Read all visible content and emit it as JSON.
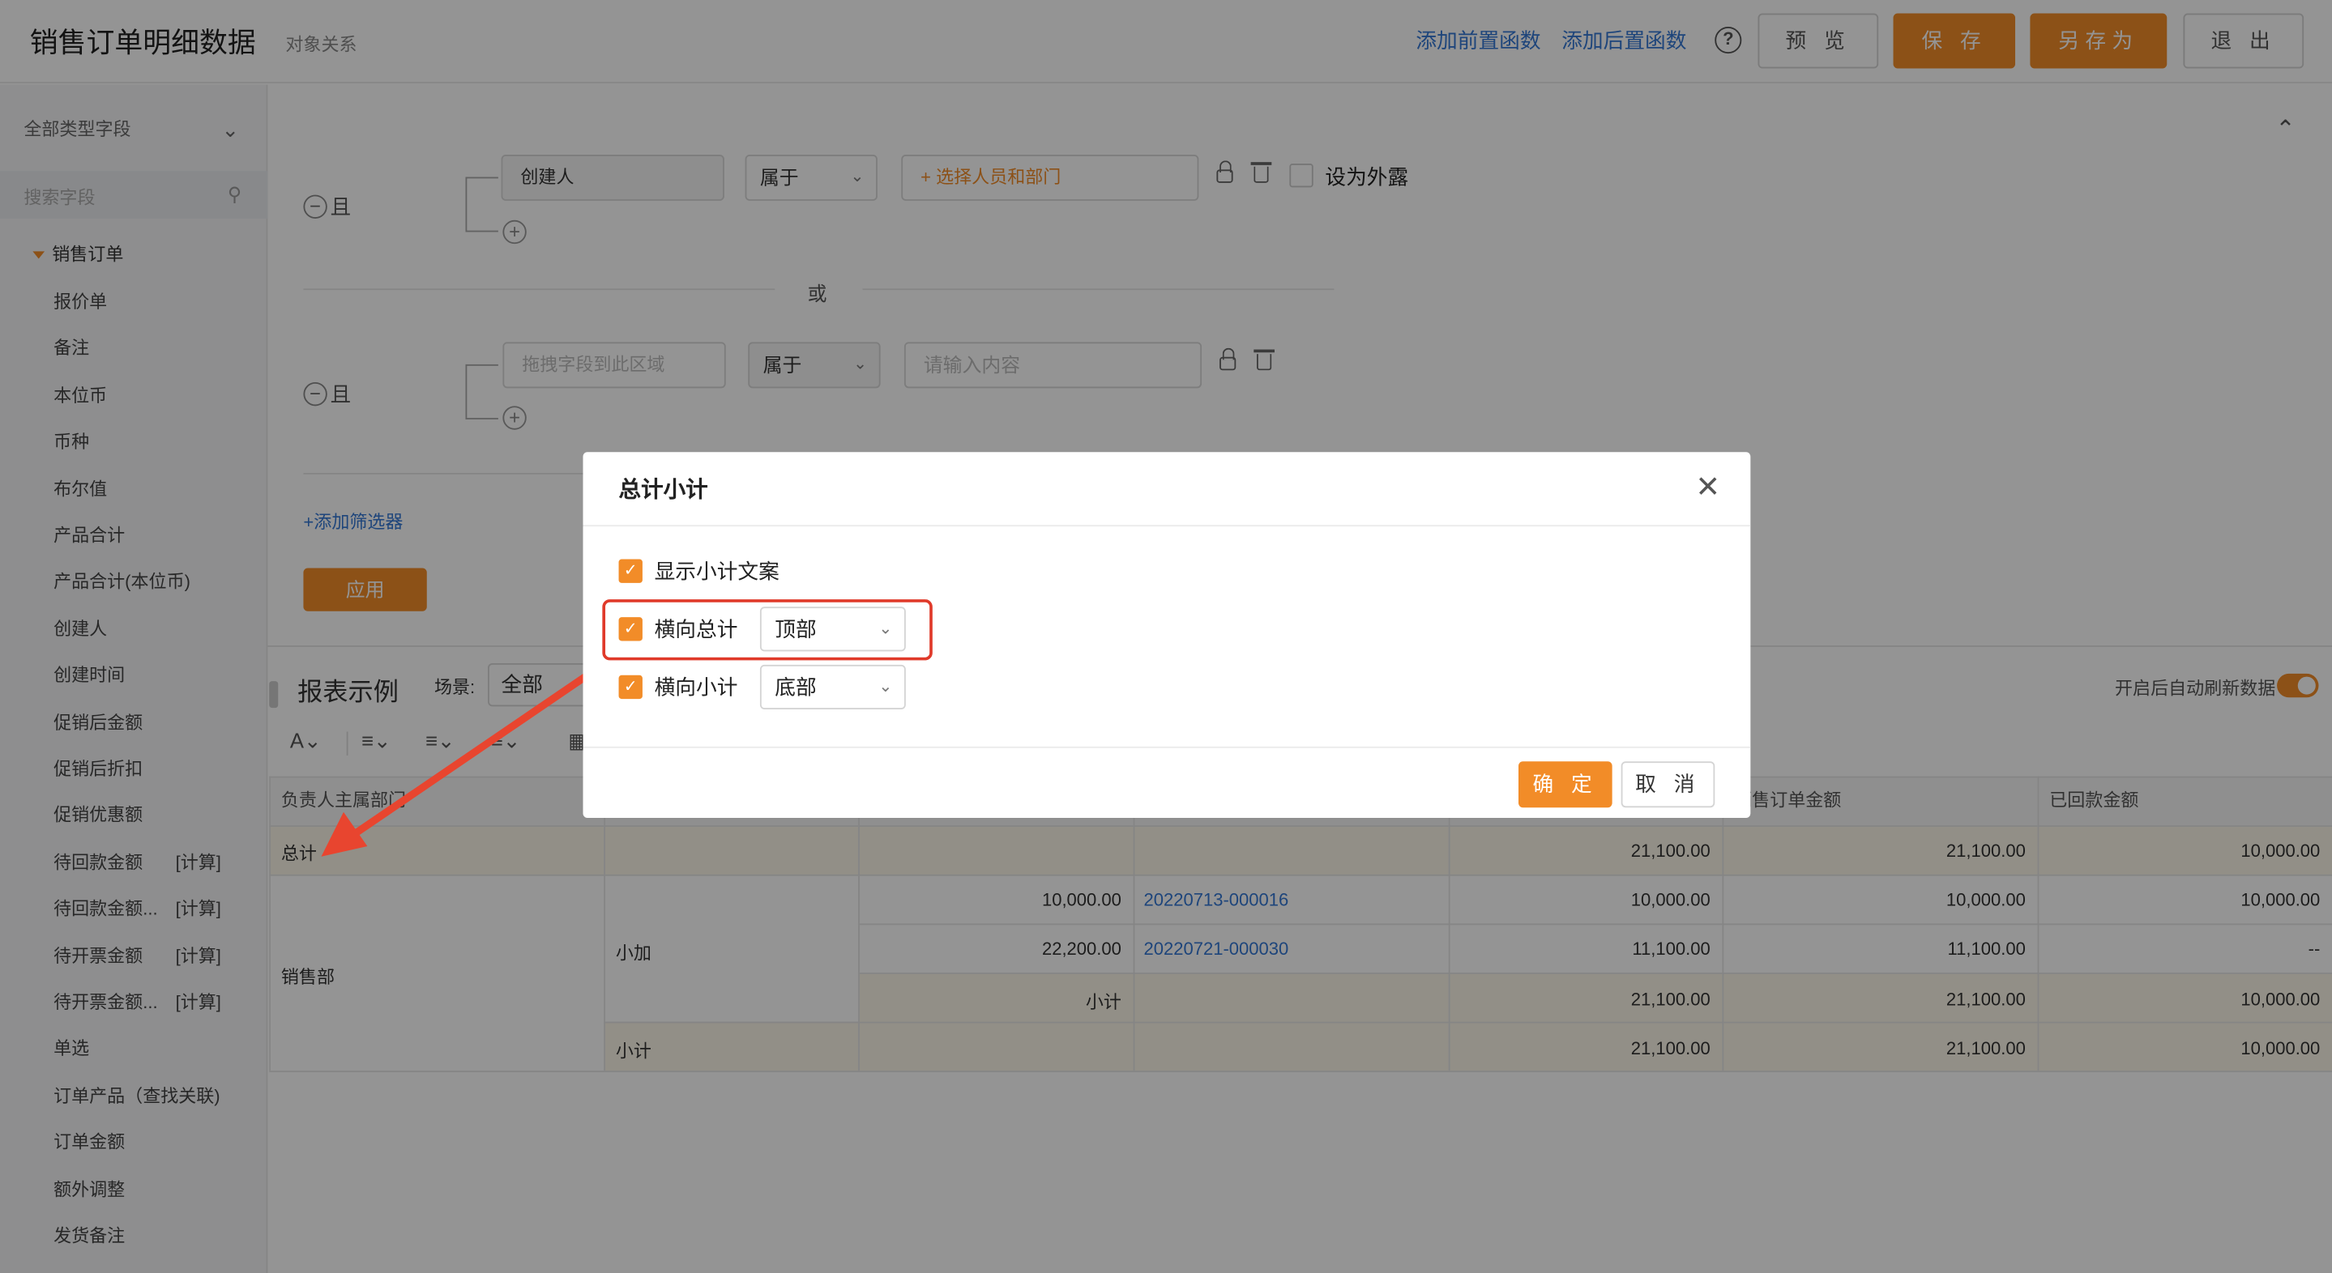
{
  "header": {
    "title": "销售订单明细数据",
    "subtitle": "对象关系",
    "add_pre_func": "添加前置函数",
    "add_post_func": "添加后置函数",
    "help": "?",
    "preview": "预 览",
    "save": "保 存",
    "save_as": "另存为",
    "exit": "退 出"
  },
  "sidebar": {
    "type_select": "全部类型字段",
    "search_placeholder": "搜索字段",
    "root": "销售订单",
    "items": [
      {
        "label": "报价单",
        "tag": ""
      },
      {
        "label": "备注",
        "tag": ""
      },
      {
        "label": "本位币",
        "tag": ""
      },
      {
        "label": "币种",
        "tag": ""
      },
      {
        "label": "布尔值",
        "tag": ""
      },
      {
        "label": "产品合计",
        "tag": ""
      },
      {
        "label": "产品合计(本位币)",
        "tag": ""
      },
      {
        "label": "创建人",
        "tag": ""
      },
      {
        "label": "创建时间",
        "tag": ""
      },
      {
        "label": "促销后金额",
        "tag": ""
      },
      {
        "label": "促销后折扣",
        "tag": ""
      },
      {
        "label": "促销优惠额",
        "tag": ""
      },
      {
        "label": "待回款金额",
        "tag": "[计算]"
      },
      {
        "label": "待回款金额...",
        "tag": "[计算]"
      },
      {
        "label": "待开票金额",
        "tag": "[计算]"
      },
      {
        "label": "待开票金额...",
        "tag": "[计算]"
      },
      {
        "label": "单选",
        "tag": ""
      },
      {
        "label": "订单产品（查找关联)",
        "tag": ""
      },
      {
        "label": "订单金额",
        "tag": ""
      },
      {
        "label": "额外调整",
        "tag": ""
      },
      {
        "label": "发货备注",
        "tag": ""
      }
    ]
  },
  "filters": {
    "and_label": "且",
    "or_label": "或",
    "group1": {
      "field": "创建人",
      "operator": "属于",
      "value_placeholder": "+ 选择人员和部门",
      "expose_label": "设为外露"
    },
    "group2": {
      "field_placeholder": "拖拽字段到此区域",
      "operator": "属于",
      "value_placeholder": "请输入内容"
    },
    "add_filter": "+添加筛选器",
    "apply": "应用"
  },
  "report": {
    "title": "报表示例",
    "scene_label": "场景:",
    "scene_value": "全部",
    "auto_refresh": "开启后自动刷新数据",
    "columns": [
      "负责人主属部门",
      "",
      "",
      "",
      "",
      "销售订单金额",
      "已回款金额"
    ],
    "total_row": {
      "label": "总计",
      "c5": "21,100.00",
      "c6": "21,100.00",
      "c7": "10,000.00"
    },
    "dept": "销售部",
    "sub_group": "小加",
    "rows": [
      {
        "c3": "10,000.00",
        "c4": "20220713-000016",
        "c5": "10,000.00",
        "c6": "10,000.00",
        "c7": "10,000.00"
      },
      {
        "c3": "22,200.00",
        "c4": "20220721-000030",
        "c5": "11,100.00",
        "c6": "11,100.00",
        "c7": "--"
      }
    ],
    "inner_subtotal": {
      "label": "小计",
      "c5": "21,100.00",
      "c6": "21,100.00",
      "c7": "10,000.00"
    },
    "outer_subtotal": {
      "label": "小计",
      "c5": "21,100.00",
      "c6": "21,100.00",
      "c7": "10,000.00"
    }
  },
  "dialog": {
    "title": "总计小计",
    "show_subtotal_text": "显示小计文案",
    "horizontal_total": "横向总计",
    "horizontal_total_pos": "顶部",
    "horizontal_subtotal": "横向小计",
    "horizontal_subtotal_pos": "底部",
    "confirm": "确 定",
    "cancel": "取 消"
  },
  "colors": {
    "accent": "#f28c28",
    "link": "#3478d4",
    "annotation": "#e03a2a"
  }
}
